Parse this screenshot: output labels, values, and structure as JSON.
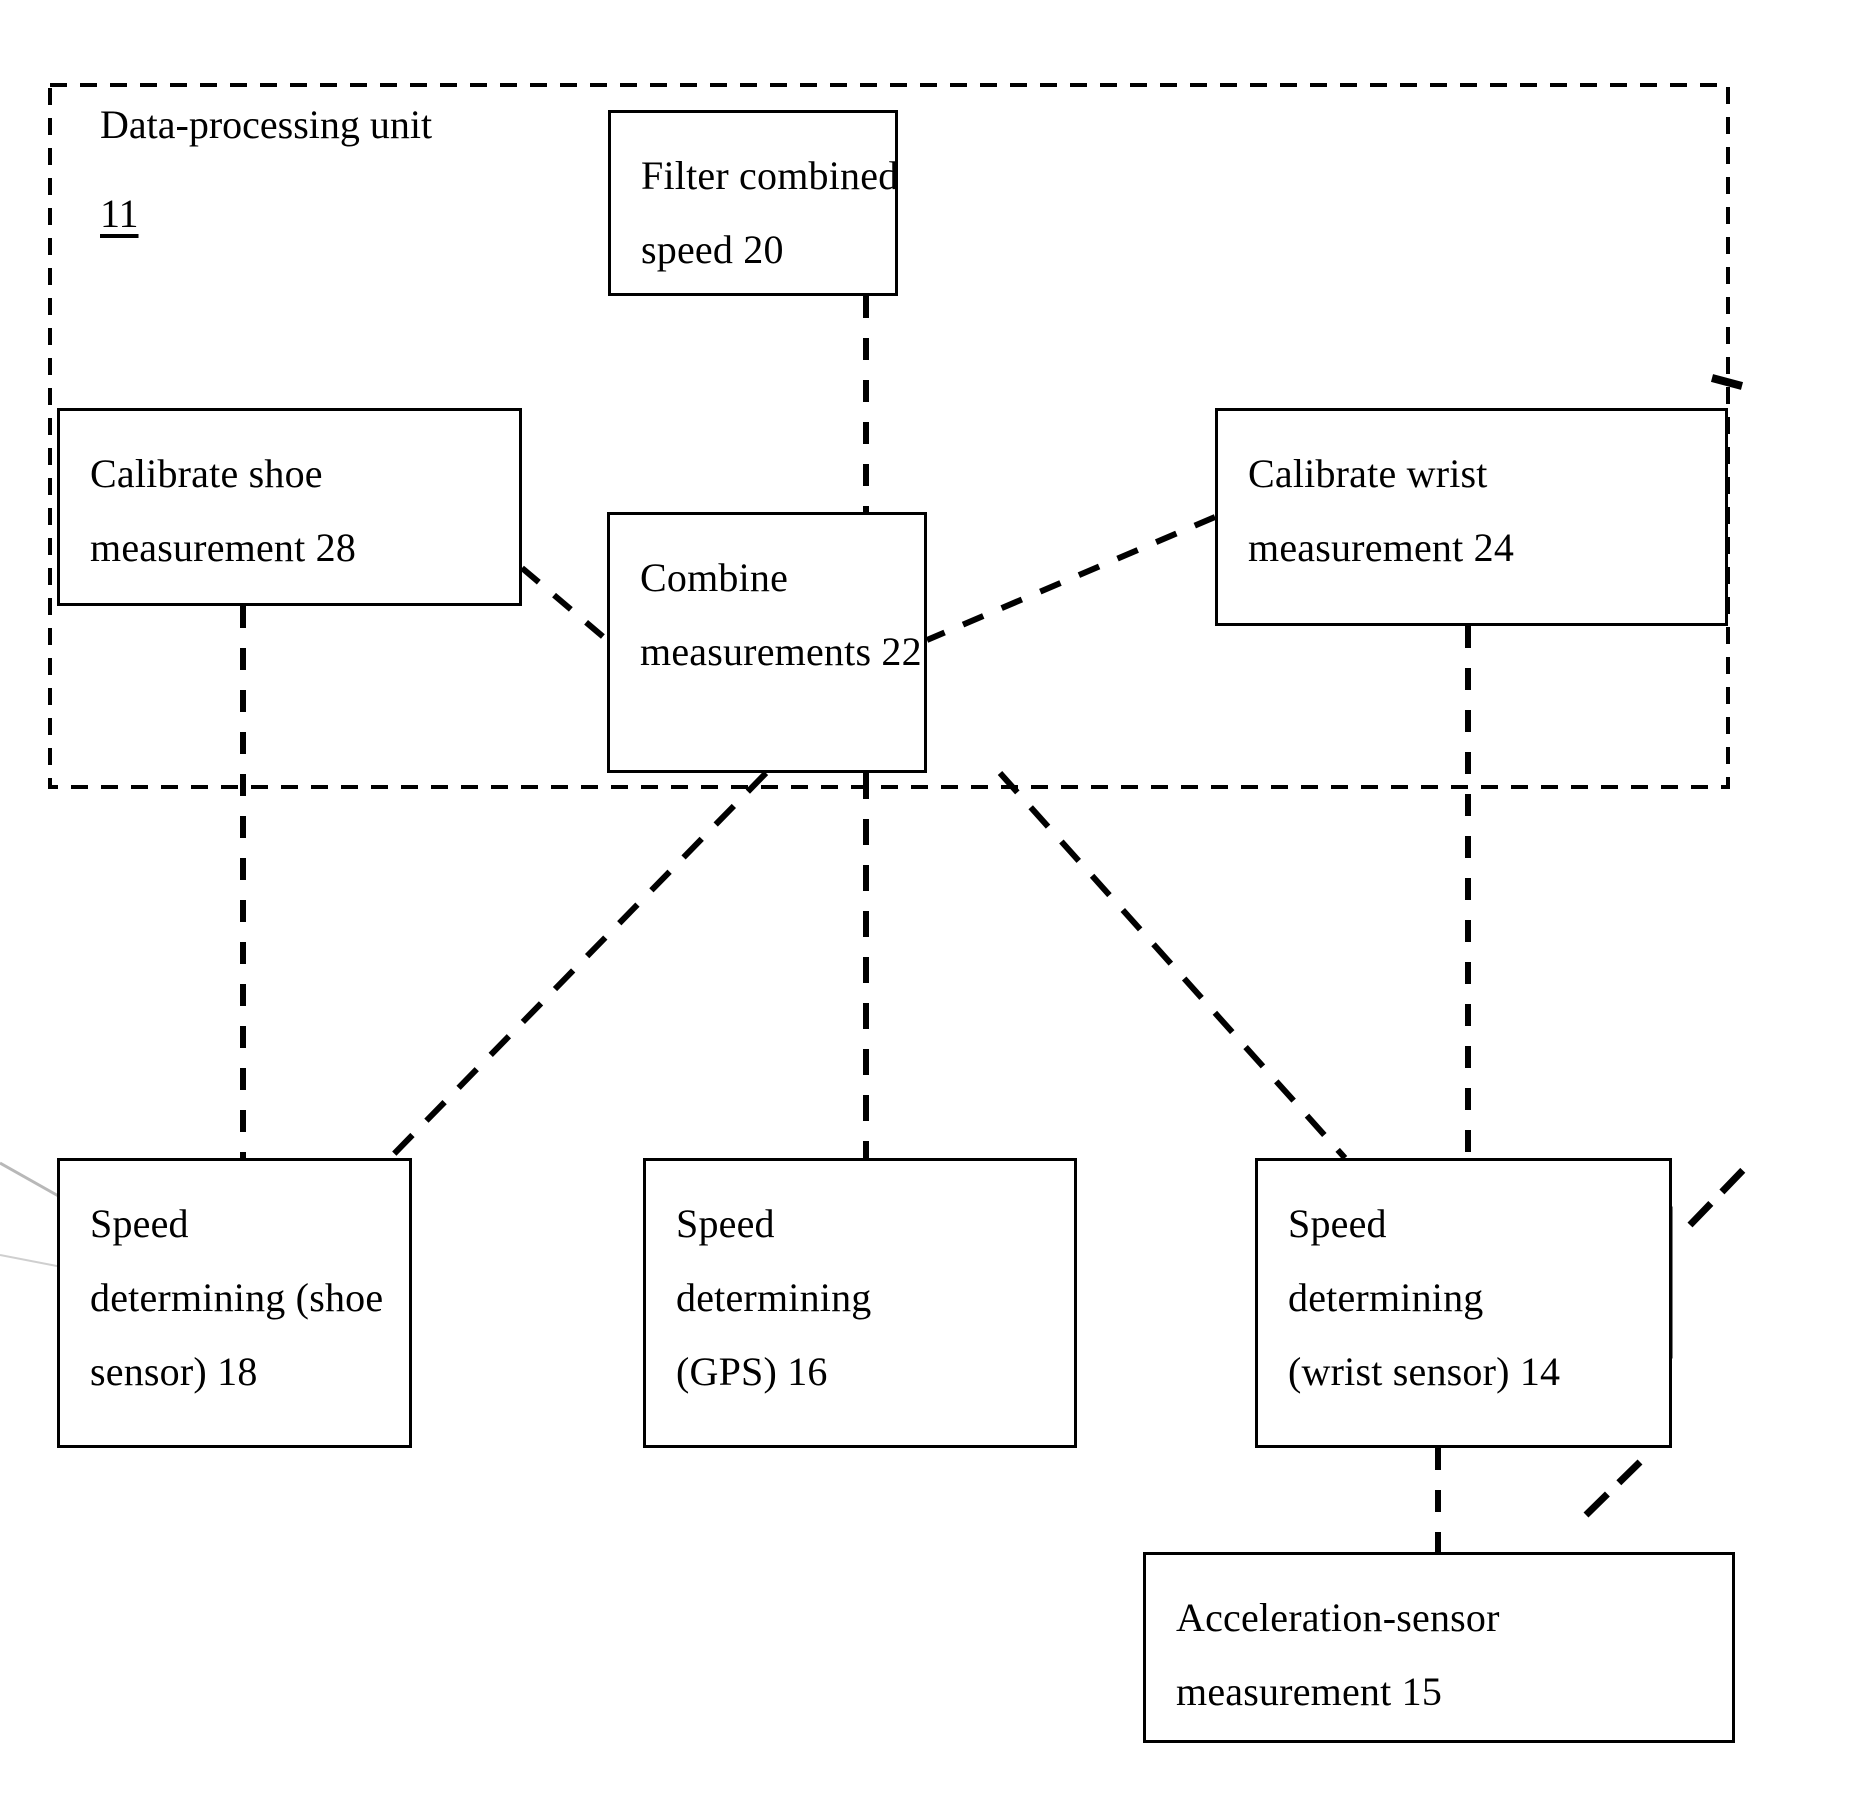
{
  "figure": {
    "type": "patent-block-diagram",
    "background": "#ffffff",
    "stroke": "#000000"
  },
  "container": {
    "name": "data-processing-unit",
    "label": "Data-processing unit",
    "reference": "11",
    "border_style": "dashed"
  },
  "nodes": [
    {
      "id": "filter-combined-speed",
      "reference": "20",
      "lines": [
        "Filter combined",
        "speed 20"
      ]
    },
    {
      "id": "calibrate-shoe-measurement",
      "reference": "28",
      "lines": [
        "Calibrate shoe",
        "measurement 28"
      ]
    },
    {
      "id": "combine-measurements",
      "reference": "22",
      "lines": [
        "Combine",
        "measurements 22"
      ]
    },
    {
      "id": "calibrate-wrist-measurement",
      "reference": "24",
      "lines": [
        "Calibrate wrist",
        "measurement 24"
      ]
    },
    {
      "id": "speed-determining-shoe-sensor",
      "reference": "18",
      "lines": [
        "Speed",
        "determining (shoe",
        "sensor) 18"
      ]
    },
    {
      "id": "speed-determining-gps",
      "reference": "16",
      "lines": [
        "Speed",
        "determining",
        "(GPS) 16"
      ]
    },
    {
      "id": "speed-determining-wrist-sensor",
      "reference": "14",
      "lines": [
        "Speed",
        "determining",
        "(wrist sensor) 14"
      ]
    },
    {
      "id": "acceleration-sensor-measurement",
      "reference": "15",
      "lines": [
        "Acceleration-sensor",
        "measurement 15"
      ]
    }
  ],
  "connections": [
    {
      "from": "filter-combined-speed",
      "to": "combine-measurements",
      "style": "dashed"
    },
    {
      "from": "calibrate-shoe-measurement",
      "to": "combine-measurements",
      "style": "dashed"
    },
    {
      "from": "calibrate-wrist-measurement",
      "to": "combine-measurements",
      "style": "dashed"
    },
    {
      "from": "calibrate-shoe-measurement",
      "to": "speed-determining-shoe-sensor",
      "style": "dashed"
    },
    {
      "from": "calibrate-wrist-measurement",
      "to": "speed-determining-wrist-sensor",
      "style": "dashed"
    },
    {
      "from": "combine-measurements",
      "to": "speed-determining-shoe-sensor",
      "style": "dashed"
    },
    {
      "from": "combine-measurements",
      "to": "speed-determining-gps",
      "style": "dashed"
    },
    {
      "from": "combine-measurements",
      "to": "speed-determining-wrist-sensor",
      "style": "dashed"
    },
    {
      "from": "speed-determining-wrist-sensor",
      "to": "acceleration-sensor-measurement",
      "style": "dashed"
    }
  ]
}
